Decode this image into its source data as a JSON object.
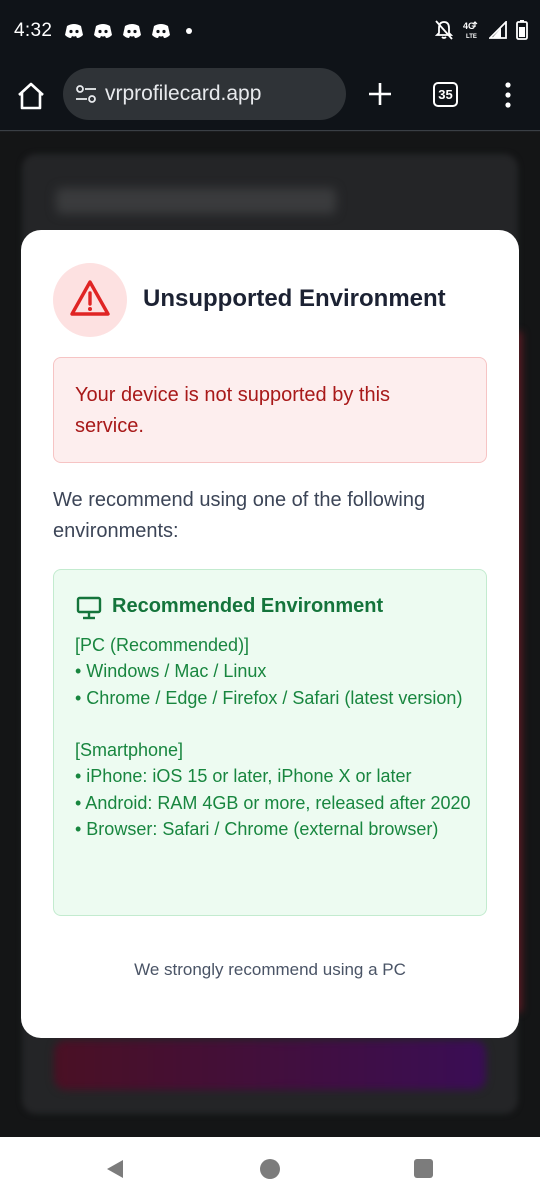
{
  "status_bar": {
    "time": "4:32",
    "notification_icons": [
      "discord-icon",
      "discord-icon",
      "discord-icon",
      "discord-icon"
    ],
    "network_label": "4G LTE"
  },
  "browser": {
    "url": "vrprofilecard.app",
    "tab_count": "35"
  },
  "modal": {
    "title": "Unsupported Environment",
    "error_message": "Your device is not supported by this service.",
    "recommend_text": "We recommend using one of the following environments:",
    "env_box": {
      "title": "Recommended Environment",
      "lines": [
        "[PC (Recommended)]",
        "• Windows / Mac / Linux",
        "• Chrome / Edge / Firefox / Safari (latest version)",
        "",
        "[Smartphone]",
        "• iPhone: iOS 15 or later, iPhone X or later",
        "• Android: RAM 4GB or more, released after 2020",
        "• Browser: Safari / Chrome (external browser)"
      ]
    },
    "footer_note": "We strongly recommend using a PC"
  },
  "colors": {
    "error_text": "#a81919",
    "error_bg": "#fdeeee",
    "success_text": "#18863f",
    "success_bg": "#edfbf1",
    "warning_icon": "#e02424"
  }
}
